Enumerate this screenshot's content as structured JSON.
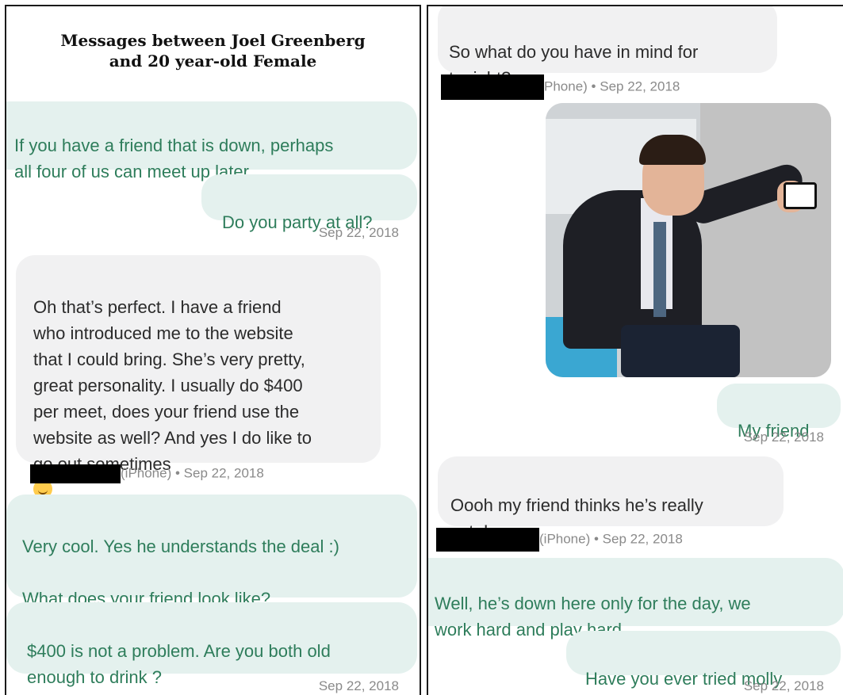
{
  "caption": "Messages between Joel Greenberg\nand 20 year-old Female",
  "left": {
    "msg1": "If you have a friend that is down, perhaps\nall four of us can meet up later.",
    "msg2": "Do you party at all?",
    "ts1": "Sep 22, 2018",
    "msg3": "Oh that’s perfect. I have a friend\nwho introduced me to the website\nthat I could bring. She’s very pretty,\ngreat personality. I usually do $400\nper meet, does your friend use the\nwebsite as well? And yes I do like to\ngo out sometimes",
    "meta3_device": "(iPhone)",
    "meta3_date": "Sep 22, 2018",
    "msg4": "Very cool. Yes he understands the deal :)\n\nWhat does your friend look like?",
    "msg5": "$400 is not a problem. Are you both old\nenough to drink ?",
    "ts2": "Sep 22, 2018"
  },
  "right": {
    "msg1": "So what do you have in mind for\ntonight?",
    "meta1_device": "Phone)",
    "meta1_date": "Sep 22, 2018",
    "msg2": "My friend",
    "ts1": "Sep 22, 2018",
    "msg3": "Oooh my friend thinks he’s really\ncute!",
    "meta3_device": "(iPhone)",
    "meta3_date": "Sep 22, 2018",
    "msg4": "Well, he’s down here only for the day, we\nwork hard and play hard.",
    "msg5": "Have you ever tried molly",
    "ts2": "Sep 22, 2018"
  },
  "meta_separator": " • ",
  "colors": {
    "incoming_bg": "#f1f1f2",
    "outgoing_bg": "#e4f1ee",
    "outgoing_text": "#2e7d5b",
    "redaction": "#000000"
  }
}
